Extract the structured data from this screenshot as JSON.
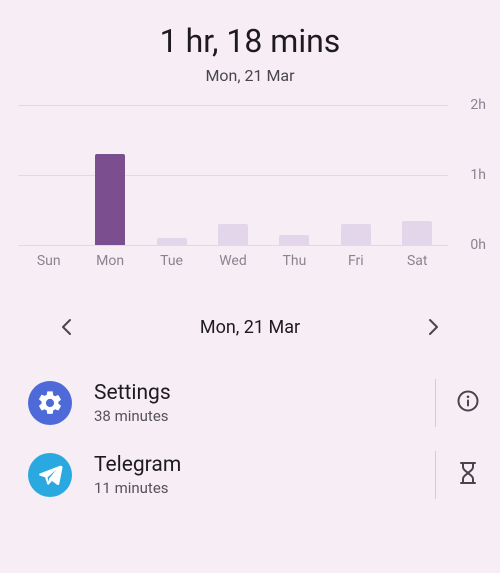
{
  "header": {
    "total_time": "1 hr, 18 mins",
    "date": "Mon, 21 Mar"
  },
  "chart_data": {
    "type": "bar",
    "categories": [
      "Sun",
      "Mon",
      "Tue",
      "Wed",
      "Thu",
      "Fri",
      "Sat"
    ],
    "values": [
      0,
      1.3,
      0.1,
      0.3,
      0.15,
      0.3,
      0.35
    ],
    "ylabel": "",
    "xlabel": "",
    "title": "",
    "ylim": [
      0,
      2
    ],
    "yticks": [
      0,
      1,
      2
    ],
    "ytick_labels": [
      "0h",
      "1h",
      "2h"
    ],
    "selected_index": 1,
    "colors": {
      "selected": "#7b4e90",
      "unselected": "#e3d6ea"
    }
  },
  "date_nav": {
    "label": "Mon, 21 Mar"
  },
  "apps": [
    {
      "name": "Settings",
      "duration": "38 minutes",
      "icon": "settings-icon",
      "icon_bg": "#4d6ad8",
      "action": "info-icon"
    },
    {
      "name": "Telegram",
      "duration": "11 minutes",
      "icon": "telegram-icon",
      "icon_bg": "#2aa9e0",
      "action": "hourglass-icon"
    }
  ]
}
